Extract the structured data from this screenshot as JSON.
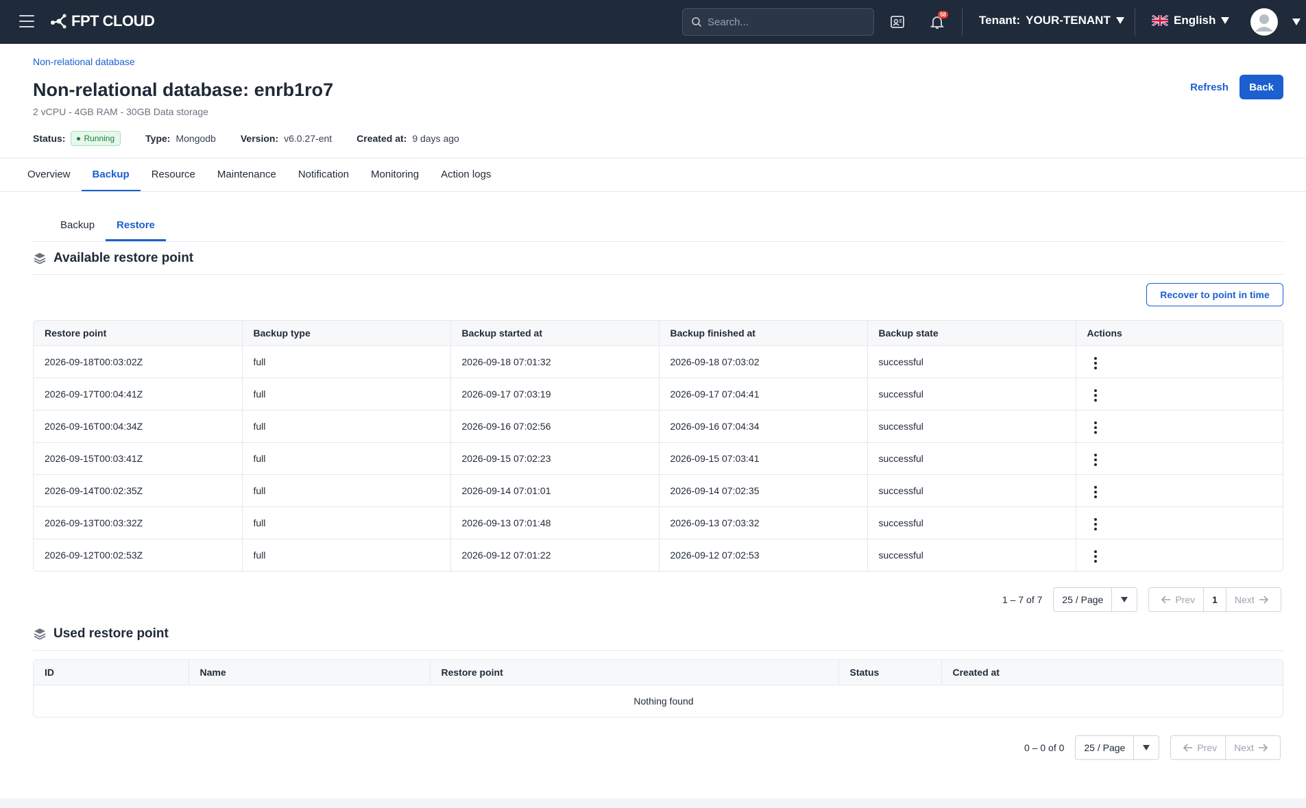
{
  "nav": {
    "brand": "FPT CLOUD",
    "search_placeholder": "Search...",
    "notification_count": "58",
    "tenant_label": "Tenant:",
    "tenant_value": "YOUR-TENANT",
    "language": "English"
  },
  "header": {
    "breadcrumb": "Non-relational database",
    "title": "Non-relational database: enrb1ro7",
    "subtitle": "2 vCPU - 4GB RAM - 30GB Data storage",
    "status_label": "Status:",
    "status_value": "Running",
    "type_label": "Type:",
    "type_value": "Mongodb",
    "version_label": "Version:",
    "version_value": "v6.0.27-ent",
    "created_label": "Created at:",
    "created_value": "9 days ago",
    "refresh_label": "Refresh",
    "back_label": "Back"
  },
  "tabs": [
    "Overview",
    "Backup",
    "Resource",
    "Maintenance",
    "Notification",
    "Monitoring",
    "Action logs"
  ],
  "active_tab": "Backup",
  "subtabs": [
    "Backup",
    "Restore"
  ],
  "active_subtab": "Restore",
  "available": {
    "title": "Available restore point",
    "recover_label": "Recover to point in time",
    "columns": [
      "Restore point",
      "Backup type",
      "Backup started at",
      "Backup finished at",
      "Backup state",
      "Actions"
    ],
    "rows": [
      [
        "2026-09-18T00:03:02Z",
        "full",
        "2026-09-18 07:01:32",
        "2026-09-18 07:03:02",
        "successful"
      ],
      [
        "2026-09-17T00:04:41Z",
        "full",
        "2026-09-17 07:03:19",
        "2026-09-17 07:04:41",
        "successful"
      ],
      [
        "2026-09-16T00:04:34Z",
        "full",
        "2026-09-16 07:02:56",
        "2026-09-16 07:04:34",
        "successful"
      ],
      [
        "2026-09-15T00:03:41Z",
        "full",
        "2026-09-15 07:02:23",
        "2026-09-15 07:03:41",
        "successful"
      ],
      [
        "2026-09-14T00:02:35Z",
        "full",
        "2026-09-14 07:01:01",
        "2026-09-14 07:02:35",
        "successful"
      ],
      [
        "2026-09-13T00:03:32Z",
        "full",
        "2026-09-13 07:01:48",
        "2026-09-13 07:03:32",
        "successful"
      ],
      [
        "2026-09-12T00:02:53Z",
        "full",
        "2026-09-12 07:01:22",
        "2026-09-12 07:02:53",
        "successful"
      ]
    ],
    "pager": {
      "range": "1 – 7 of 7",
      "page_size": "25 / Page",
      "prev": "Prev",
      "page": "1",
      "next": "Next"
    }
  },
  "used": {
    "title": "Used restore point",
    "columns": [
      "ID",
      "Name",
      "Restore point",
      "Status",
      "Created at"
    ],
    "empty": "Nothing found",
    "pager": {
      "range": "0 – 0 of 0",
      "page_size": "25 / Page",
      "prev": "Prev",
      "next": "Next"
    }
  },
  "colors": {
    "navbar": "#1f2a3a",
    "accent": "#1b5fd1",
    "running": "#16803c"
  }
}
